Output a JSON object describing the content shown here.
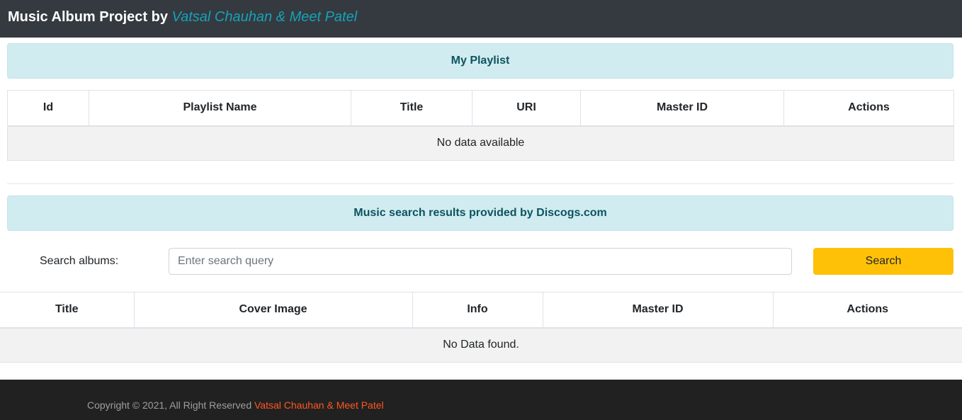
{
  "navbar": {
    "brand_prefix": "Music Album Project by ",
    "brand_authors": "Vatsal Chauhan & Meet Patel"
  },
  "playlist": {
    "heading": "My Playlist",
    "columns": [
      "Id",
      "Playlist Name",
      "Title",
      "URI",
      "Master ID",
      "Actions"
    ],
    "empty_message": "No data available"
  },
  "search": {
    "heading": "Music search results provided by Discogs.com",
    "label": "Search albums:",
    "placeholder": "Enter search query",
    "value": "",
    "button_label": "Search"
  },
  "results": {
    "columns": [
      "Title",
      "Cover Image",
      "Info",
      "Master ID",
      "Actions"
    ],
    "empty_message": "No Data found."
  },
  "footer": {
    "copyright_text": "Copyright © 2021, All Right Reserved ",
    "authors_link": "Vatsal Chauhan & Meet Patel"
  },
  "colors": {
    "navbar_bg": "#343a40",
    "brand_accent": "#17a2b8",
    "alert_bg": "#d1ecf1",
    "alert_text": "#0c5460",
    "search_button": "#ffc107",
    "footer_bg": "#212121",
    "footer_link": "#ff5722"
  }
}
